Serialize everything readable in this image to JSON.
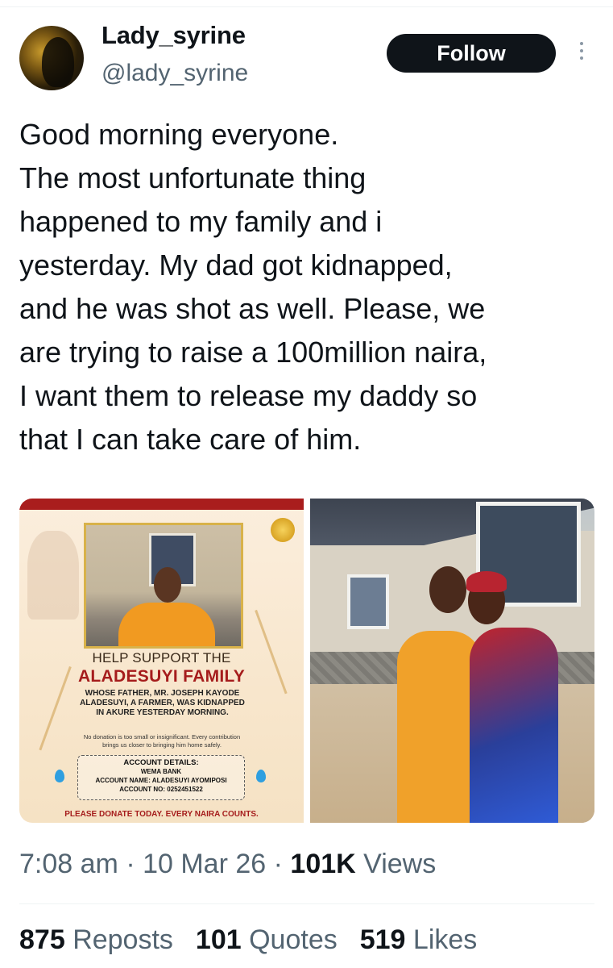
{
  "author": {
    "display_name": "Lady_syrine",
    "handle": "@lady_syrine",
    "follow_label": "Follow"
  },
  "tweet": {
    "lines": [
      "Good morning everyone.",
      "The most unfortunate thing",
      "happened to my family and i",
      "yesterday. My dad got kidnapped,",
      "and he was shot as well. Please, we",
      "are trying to raise a 100million naira,",
      "I want them to release my daddy so",
      "that I can take care of him."
    ]
  },
  "flyer": {
    "heading_1": "HELP SUPPORT THE",
    "heading_2": "ALADESUYI FAMILY",
    "body_lines": [
      "WHOSE FATHER, MR. JOSEPH KAYODE",
      "ALADESUYI, A FARMER, WAS KIDNAPPED",
      "IN AKURE YESTERDAY MORNING."
    ],
    "note_lines": [
      "No donation is too small or insignificant. Every contribution",
      "brings us closer to bringing him home safely."
    ],
    "account": {
      "title": "ACCOUNT DETAILS:",
      "bank": "WEMA BANK",
      "name": "ACCOUNT NAME: ALADESUYI AYOMIPOSI",
      "number": "ACCOUNT NO: 0252451522"
    },
    "footer": "PLEASE DONATE TODAY. EVERY NAIRA COUNTS.",
    "accent_color": "#a51c1c"
  },
  "meta": {
    "time": "7:08 am",
    "separator": "·",
    "date": "10 Mar 26",
    "views_count": "101K",
    "views_label": "Views"
  },
  "stats": {
    "reposts_count": "875",
    "reposts_label": "Reposts",
    "quotes_count": "101",
    "quotes_label": "Quotes",
    "likes_count": "519",
    "likes_label": "Likes"
  },
  "icons": {
    "more": "more-vertical-icon",
    "drop": "water-drop-icon"
  }
}
